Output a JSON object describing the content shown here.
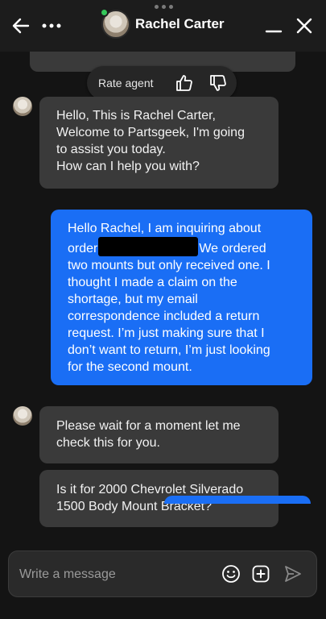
{
  "header": {
    "agent_name": "Rachel Carter"
  },
  "rate_bar": {
    "label": "Rate agent"
  },
  "messages": [
    {
      "sender": "agent",
      "lines": [
        "Hello, This is Rachel Carter,",
        "Welcome to Partsgeek, I'm going",
        "to assist you today.",
        "How can I help you with?"
      ]
    },
    {
      "sender": "user",
      "line1_a": "Hello Rachel, I am inquiring about",
      "line2_a": "order",
      "line2_b": "We ordered",
      "lines_rest": [
        "two mounts but only received one. I",
        "thought I made a claim on the",
        "shortage, but my email",
        "correspondence included a return",
        "request. I’m just making sure that I",
        "don’t want to return, I’m just looking",
        "for the second mount."
      ]
    },
    {
      "sender": "agent",
      "lines": [
        "Please wait for a moment let me",
        "check this for you."
      ]
    },
    {
      "sender": "agent",
      "lines": [
        "Is it for 2000 Chevrolet Silverado",
        "1500 Body Mount Bracket?"
      ]
    }
  ],
  "composer": {
    "placeholder": "Write a message"
  },
  "colors": {
    "background": "#141414",
    "agent_bubble": "#3a3a3a",
    "user_bubble": "#1a6ef5",
    "online": "#35c759"
  },
  "icons": [
    "back-arrow-icon",
    "more-icon",
    "minimize-icon",
    "close-icon",
    "thumbs-up-icon",
    "thumbs-down-icon",
    "emoji-icon",
    "attach-plus-icon",
    "send-icon"
  ]
}
